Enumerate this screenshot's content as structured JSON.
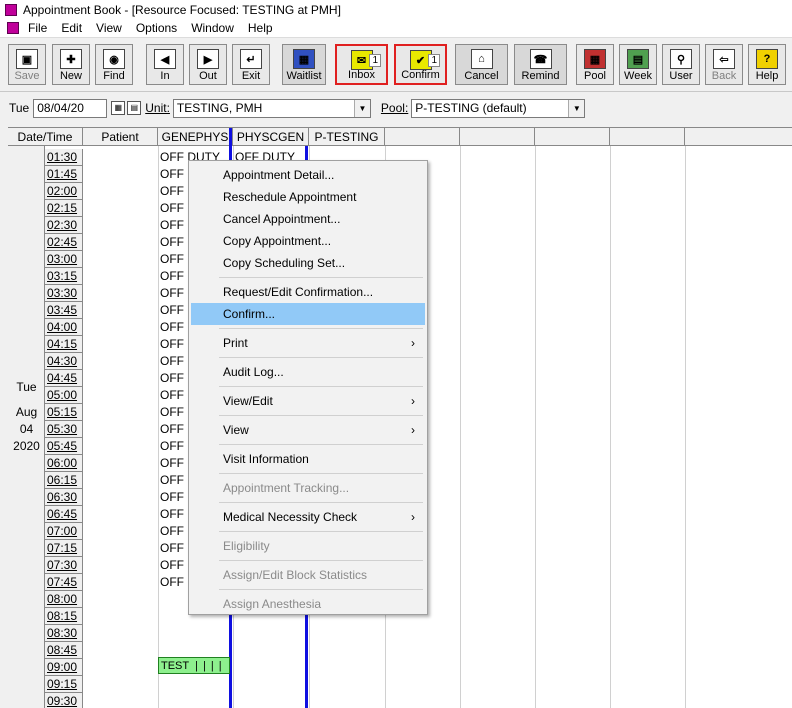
{
  "window": {
    "title": "Appointment Book - [Resource Focused:  TESTING at PMH]"
  },
  "menu": [
    "File",
    "Edit",
    "View",
    "Options",
    "Window",
    "Help"
  ],
  "toolbar": [
    {
      "label": "Save",
      "icon": "save-icon",
      "disabled": true
    },
    {
      "label": "New",
      "icon": "new-icon"
    },
    {
      "label": "Find",
      "icon": "binoculars-icon"
    },
    {
      "label": "In",
      "icon": "check-in-icon"
    },
    {
      "label": "Out",
      "icon": "check-out-icon"
    },
    {
      "label": "Exit",
      "icon": "exit-icon"
    },
    {
      "label": "Waitlist",
      "icon": "waitlist-icon"
    },
    {
      "label": "Inbox",
      "icon": "inbox-icon",
      "count": "1",
      "highlight": true
    },
    {
      "label": "Confirm",
      "icon": "confirm-icon",
      "count": "1",
      "highlight": true
    },
    {
      "label": "Cancel",
      "icon": "cancel-icon"
    },
    {
      "label": "Remind",
      "icon": "remind-icon"
    },
    {
      "label": "Pool",
      "icon": "pool-icon"
    },
    {
      "label": "Week",
      "icon": "week-icon"
    },
    {
      "label": "User",
      "icon": "user-icon"
    },
    {
      "label": "Back",
      "icon": "back-icon",
      "disabled": true
    },
    {
      "label": "Help",
      "icon": "help-icon"
    }
  ],
  "filter": {
    "day": "Tue",
    "date": "08/04/20",
    "unit_label": "Unit:",
    "unit_value": "TESTING, PMH",
    "pool_label": "Pool:",
    "pool_value": "P-TESTING (default)"
  },
  "columns": [
    "Date/Time",
    "Patient",
    "GENEPHYS",
    "PHYSCGEN",
    "P-TESTING"
  ],
  "date_label": [
    "Tue",
    "Aug",
    "04",
    "2020"
  ],
  "times": [
    "01:30",
    "01:45",
    "02:00",
    "02:15",
    "02:30",
    "02:45",
    "03:00",
    "03:15",
    "03:30",
    "03:45",
    "04:00",
    "04:15",
    "04:30",
    "04:45",
    "05:00",
    "05:15",
    "05:30",
    "05:45",
    "06:00",
    "06:15",
    "06:30",
    "06:45",
    "07:00",
    "07:15",
    "07:30",
    "07:45",
    "08:00",
    "08:15",
    "08:30",
    "08:45",
    "09:00",
    "09:15",
    "09:30"
  ],
  "off_duty_text": "OFF DUTY",
  "off_duty_short": "OFF I",
  "appointment": {
    "label": "TEST"
  },
  "context_menu": [
    {
      "label": "Appointment Detail..."
    },
    {
      "label": "Reschedule Appointment"
    },
    {
      "label": "Cancel Appointment..."
    },
    {
      "label": "Copy Appointment..."
    },
    {
      "label": "Copy Scheduling Set..."
    },
    {
      "separator": true
    },
    {
      "label": "Request/Edit Confirmation..."
    },
    {
      "label": "Confirm...",
      "highlight": true
    },
    {
      "separator": true
    },
    {
      "label": "Print",
      "submenu": true
    },
    {
      "separator": true
    },
    {
      "label": "Audit Log..."
    },
    {
      "separator": true
    },
    {
      "label": "View/Edit",
      "submenu": true
    },
    {
      "separator": true
    },
    {
      "label": "View",
      "submenu": true
    },
    {
      "separator": true
    },
    {
      "label": "Visit Information"
    },
    {
      "separator": true
    },
    {
      "label": "Appointment Tracking...",
      "disabled": true
    },
    {
      "separator": true
    },
    {
      "label": "Medical Necessity Check",
      "submenu": true
    },
    {
      "separator": true
    },
    {
      "label": "Eligibility",
      "disabled": true
    },
    {
      "separator": true
    },
    {
      "label": "Assign/Edit Block Statistics",
      "disabled": true
    },
    {
      "separator": true
    },
    {
      "label": "Assign Anesthesia",
      "disabled": true
    }
  ]
}
